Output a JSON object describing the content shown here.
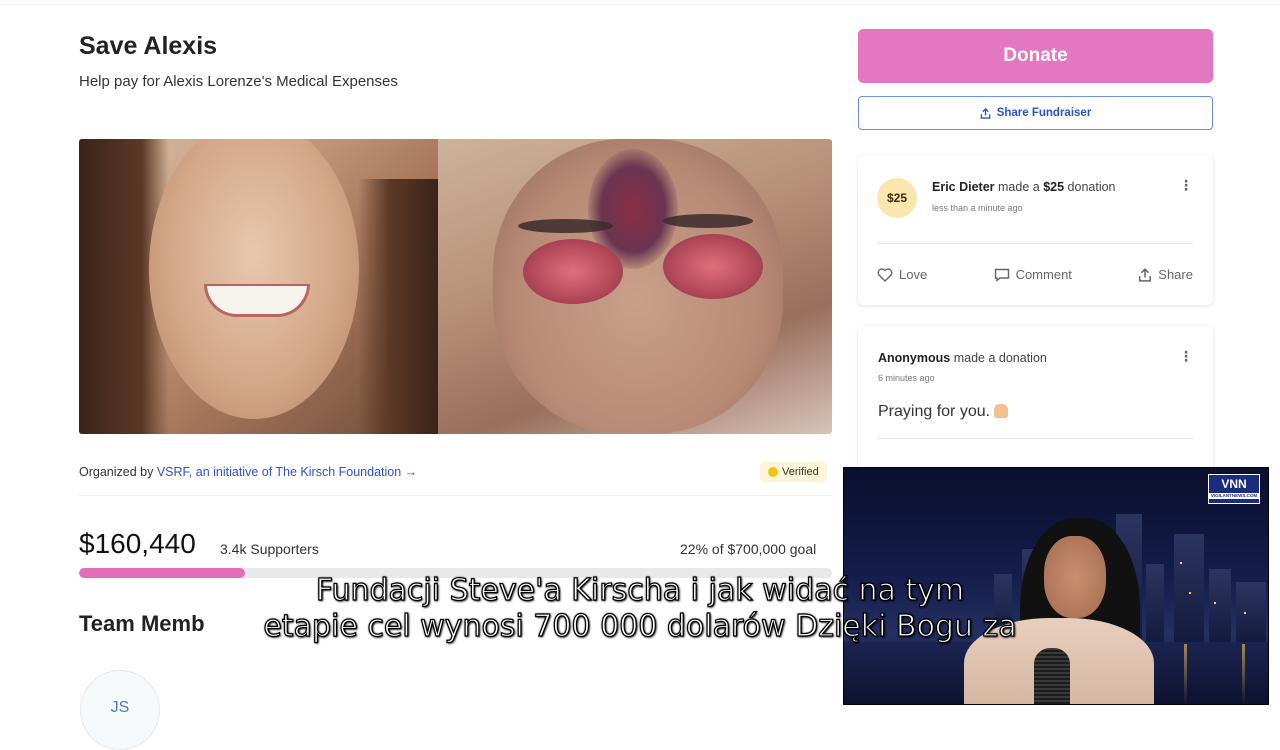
{
  "page": {
    "title": "Save Alexis",
    "subtitle": "Help pay for Alexis Lorenze's Medical Expenses",
    "organizer_prefix": "Organized by",
    "organizer_link": "VSRF, an initiative of The Kirsch Foundation",
    "organizer_arrow": "→",
    "verified": "Verified",
    "raised": "$160,440",
    "supporters": "3.4k Supporters",
    "goal": "22% of $700,000 goal",
    "progress": 0.22,
    "team_heading": "Team Memb",
    "team_initials": "JS"
  },
  "sidebar": {
    "donate": "Donate",
    "share_fundraiser": "Share Fundraiser",
    "donations": [
      {
        "badge": "$25",
        "name": "Eric Dieter",
        "action_pre": "made a",
        "amount": "$25",
        "action_post": "donation",
        "time": "less than a minute ago",
        "love": "Love",
        "comment": "Comment",
        "share": "Share"
      },
      {
        "name": "Anonymous",
        "action": "made a donation",
        "time": "6 minutes ago",
        "message": "Praying for you."
      }
    ]
  },
  "video": {
    "logo": "VNN",
    "logo_sub": "VIGILANTNEWS.COM"
  },
  "subtitles": {
    "line1": "Fundacji Steve'a Kirscha i jak widać  na tym",
    "line2": "etapie cel wynosi 700 000 dolarów  Dzięki Bogu za"
  },
  "colors": {
    "accent": "#e478c0",
    "link": "#2b52c9",
    "progress_fill": "#e46bb7"
  }
}
